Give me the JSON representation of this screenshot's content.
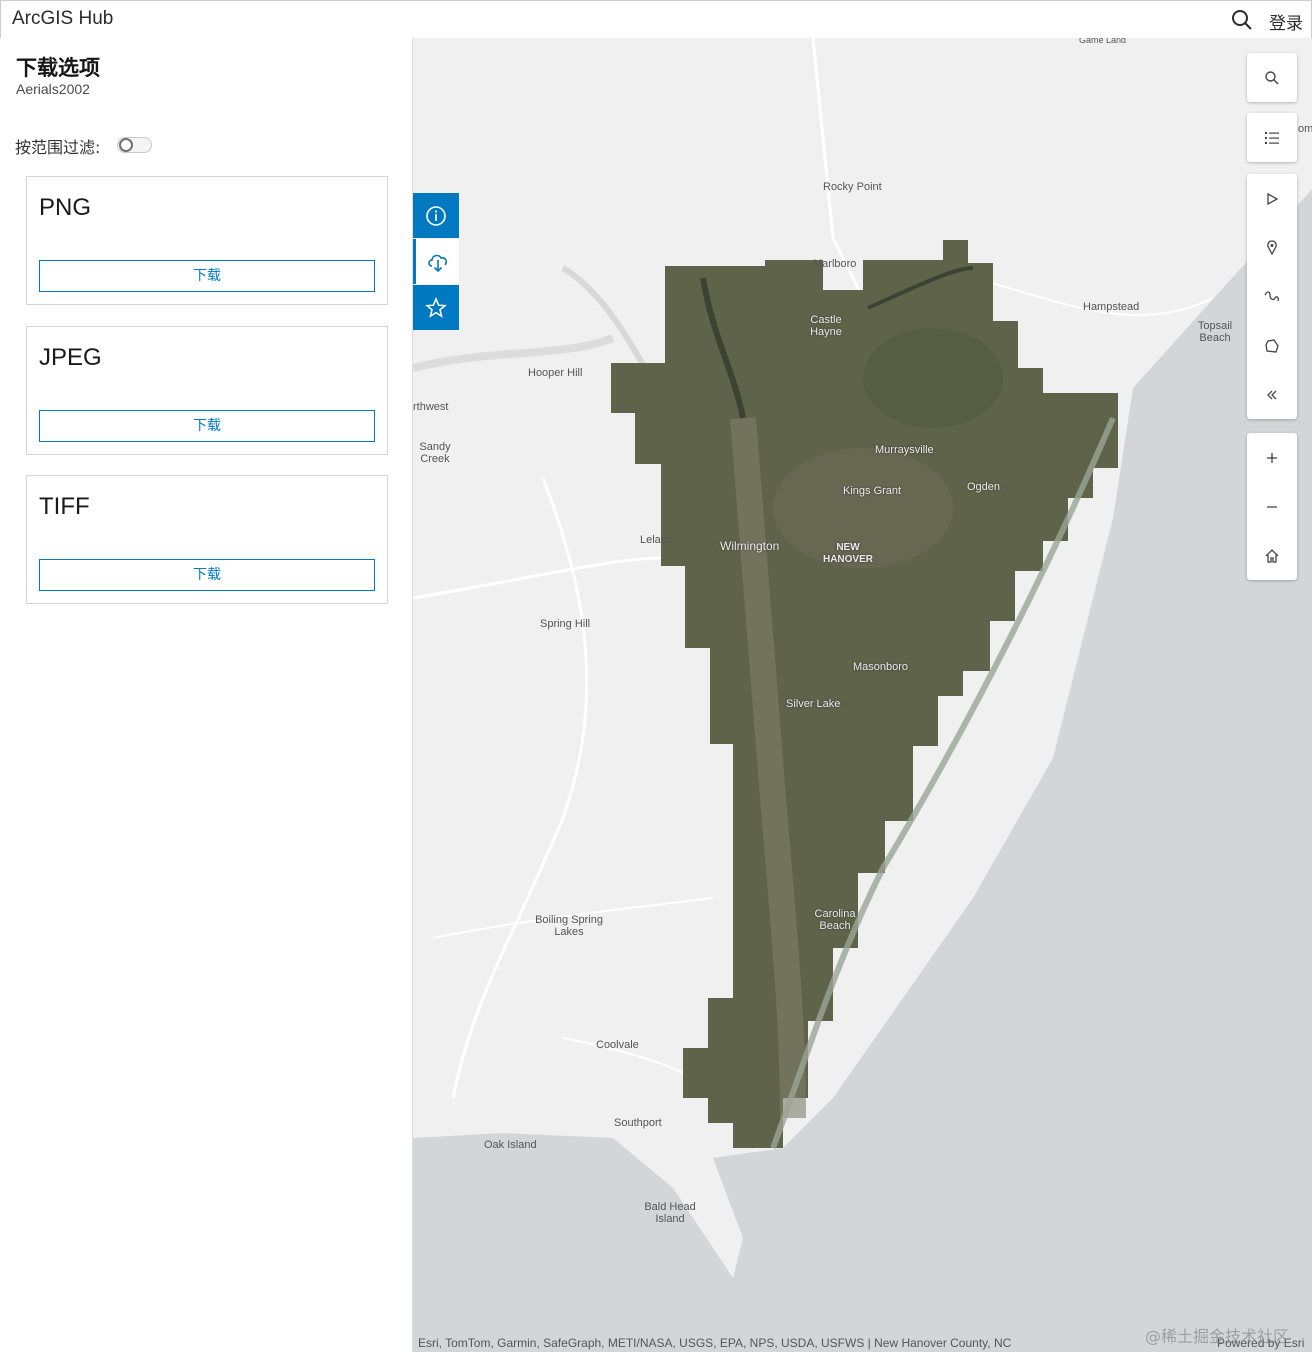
{
  "header": {
    "brand": "ArcGIS Hub",
    "login_label": "登录"
  },
  "panel": {
    "title": "下载选项",
    "subtitle": "Aerials2002",
    "filter_label": "按范围过滤:",
    "filter_enabled": false,
    "formats": [
      {
        "name": "PNG",
        "button_label": "下载"
      },
      {
        "name": "JPEG",
        "button_label": "下载"
      },
      {
        "name": "TIFF",
        "button_label": "下载"
      }
    ]
  },
  "map": {
    "places": {
      "game_land": "Game Land",
      "rocky_point": "Rocky Point",
      "marlboro": "Marlboro",
      "hampstead": "Hampstead",
      "topsail_beach": "Topsail Beach",
      "castle_hayne": "Castle Hayne",
      "hooper_hill": "Hooper Hill",
      "northwest": "rthwest",
      "sandy_creek": "Sandy Creek",
      "murraysville": "Murraysville",
      "kings_grant": "Kings Grant",
      "ogden": "Ogden",
      "leland": "Leland",
      "wilmington": "Wilmington",
      "new_hanover": "NEW HANOVER",
      "spring_hill": "Spring Hill",
      "masonboro": "Masonboro",
      "silver_lake": "Silver Lake",
      "boiling_spring_lakes": "Boiling Spring Lakes",
      "carolina_beach": "Carolina Beach",
      "coolvale": "Coolvale",
      "southport": "Southport",
      "oak_island": "Oak Island",
      "bald_head_island": "Bald Head Island",
      "edge_label": "oml"
    },
    "attribution": "Esri, TomTom, Garmin, SafeGraph, METI/NASA, USGS, EPA, NPS, USDA, USFWS | New Hanover County, NC",
    "powered_by": "Powered by Esri",
    "colors": {
      "land": "#f0f0f0",
      "water": "#d3d6d9",
      "imagery": "#5f6349",
      "accent": "#0079c1"
    }
  },
  "watermark": "@稀土掘金技术社区"
}
